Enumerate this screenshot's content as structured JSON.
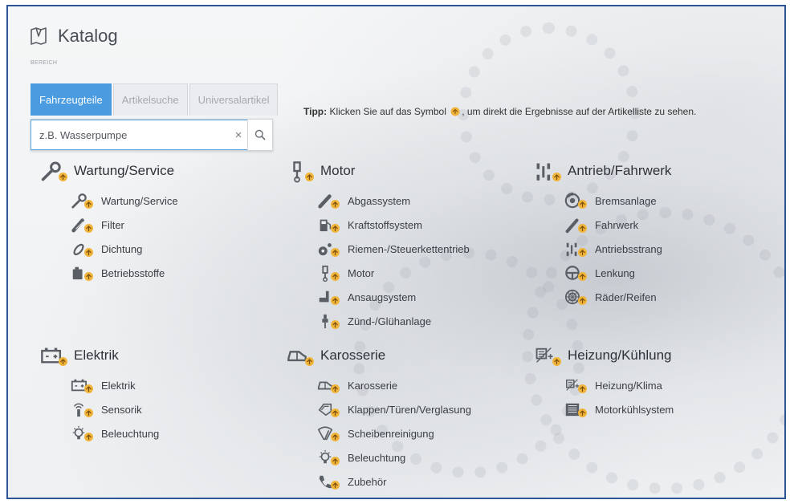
{
  "header": {
    "title": "Katalog",
    "section_label": "BEREICH"
  },
  "tabs": [
    {
      "label": "Fahrzeugteile",
      "active": true
    },
    {
      "label": "Artikelsuche",
      "active": false
    },
    {
      "label": "Universalartikel",
      "active": false
    }
  ],
  "search": {
    "placeholder": "z.B. Wasserpumpe",
    "value": "",
    "clear_symbol": "×"
  },
  "tip": {
    "label": "Tipp:",
    "text_before": "Klicken Sie auf das Symbol",
    "text_after": ", um direkt die Ergebnisse auf der Artikelliste zu sehen."
  },
  "colors": {
    "accent": "#4a9be0",
    "badge": "#f0b43a",
    "frame_border": "#2b5597",
    "icon": "#5a5f66"
  },
  "categories": [
    {
      "title": "Wartung/Service",
      "icon": "wrench-icon",
      "items": [
        {
          "label": "Wartung/Service",
          "icon": "wrench-icon"
        },
        {
          "label": "Filter",
          "icon": "filter-icon"
        },
        {
          "label": "Dichtung",
          "icon": "seal-icon"
        },
        {
          "label": "Betriebsstoffe",
          "icon": "oil-can-icon"
        }
      ]
    },
    {
      "title": "Motor",
      "icon": "engine-icon",
      "items": [
        {
          "label": "Abgassystem",
          "icon": "exhaust-icon"
        },
        {
          "label": "Kraftstoffsystem",
          "icon": "fuel-pump-icon"
        },
        {
          "label": "Riemen-/Steuerkettentrieb",
          "icon": "belt-drive-icon"
        },
        {
          "label": "Motor",
          "icon": "engine-icon"
        },
        {
          "label": "Ansaugsystem",
          "icon": "intake-icon"
        },
        {
          "label": "Zünd-/Glühanlage",
          "icon": "spark-plug-icon"
        }
      ]
    },
    {
      "title": "Antrieb/Fahrwerk",
      "icon": "drivetrain-icon",
      "items": [
        {
          "label": "Bremsanlage",
          "icon": "brake-disc-icon"
        },
        {
          "label": "Fahrwerk",
          "icon": "shock-absorber-icon"
        },
        {
          "label": "Antriebsstrang",
          "icon": "drivetrain-icon"
        },
        {
          "label": "Lenkung",
          "icon": "steering-wheel-icon"
        },
        {
          "label": "Räder/Reifen",
          "icon": "wheel-icon"
        }
      ]
    },
    {
      "title": "Elektrik",
      "icon": "battery-icon",
      "items": [
        {
          "label": "Elektrik",
          "icon": "battery-icon"
        },
        {
          "label": "Sensorik",
          "icon": "sensor-icon"
        },
        {
          "label": "Beleuchtung",
          "icon": "bulb-icon"
        }
      ]
    },
    {
      "title": "Karosserie",
      "icon": "car-body-icon",
      "items": [
        {
          "label": "Karosserie",
          "icon": "car-body-icon"
        },
        {
          "label": "Klappen/Türen/Verglasung",
          "icon": "door-icon"
        },
        {
          "label": "Scheibenreinigung",
          "icon": "wiper-icon"
        },
        {
          "label": "Beleuchtung",
          "icon": "bulb-icon"
        },
        {
          "label": "Zubehör",
          "icon": "accessory-icon"
        }
      ]
    },
    {
      "title": "Heizung/Kühlung",
      "icon": "heating-icon",
      "items": [
        {
          "label": "Heizung/Klima",
          "icon": "heating-icon"
        },
        {
          "label": "Motorkühlsystem",
          "icon": "radiator-icon"
        }
      ]
    }
  ]
}
